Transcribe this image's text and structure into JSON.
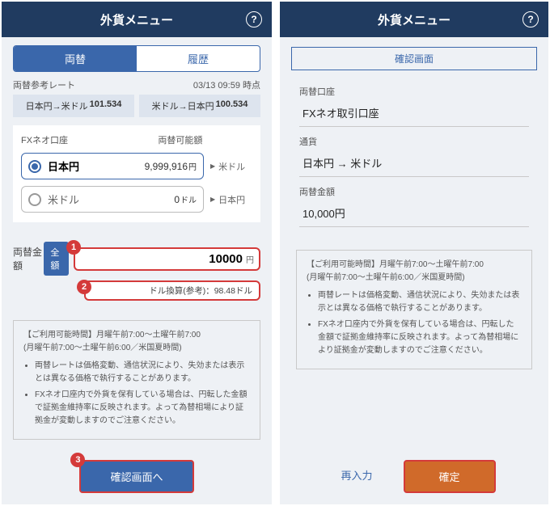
{
  "left": {
    "title": "外貨メニュー",
    "tabs": {
      "a": "両替",
      "b": "履歴"
    },
    "rate_label": "両替参考レート",
    "rate_time": "03/13 09:59 時点",
    "rate1_label": "日本円→米ドル",
    "rate1_value": "101.534",
    "rate2_label": "米ドル→日本円",
    "rate2_value": "100.534",
    "acct_label": "FXネオ口座",
    "avail_label": "両替可能額",
    "c1_name": "日本円",
    "c1_amount": "9,999,916",
    "c1_unit": "円",
    "c1_to": "米ドル",
    "c2_name": "米ドル",
    "c2_amount": "0",
    "c2_unit": "ドル",
    "c2_to": "日本円",
    "amount_label": "両替金額",
    "full_btn": "全額",
    "amount_value": "10000",
    "amount_unit": "円",
    "conv_text": "ドル換算(参考)：98.48ドル",
    "hours_title": "【ご利用可能時間】月曜午前7:00～土曜午前7:00",
    "hours_sub": "(月曜午前7:00～土曜午前6:00／米国夏時間)",
    "note1": "両替レートは価格変動、通信状況により、失効または表示とは異なる価格で執行することがあります。",
    "note2": "FXネオ口座内で外貨を保有している場合は、円転した金額で証拠金維持率に反映されます。よって為替相場により証拠金が変動しますのでご注意ください。",
    "confirm_btn": "確認画面へ",
    "markers": {
      "m1": "1",
      "m2": "2",
      "m3": "3"
    }
  },
  "right": {
    "title": "外貨メニュー",
    "confirm_header": "確認画面",
    "f1_label": "両替口座",
    "f1_value": "FXネオ取引口座",
    "f2_label": "通貨",
    "f2_value": "日本円 → 米ドル",
    "f3_label": "両替金額",
    "f3_value": "10,000円",
    "hours_title": "【ご利用可能時間】月曜午前7:00～土曜午前7:00",
    "hours_sub": "(月曜午前7:00～土曜午前6:00／米国夏時間)",
    "note1": "両替レートは価格変動、通信状況により、失効または表示とは異なる価格で執行することがあります。",
    "note2": "FXネオ口座内で外貨を保有している場合は、円転した金額で証拠金維持率に反映されます。よって為替相場により証拠金が変動しますのでご注意ください。",
    "back_btn": "再入力",
    "submit_btn": "確定"
  }
}
